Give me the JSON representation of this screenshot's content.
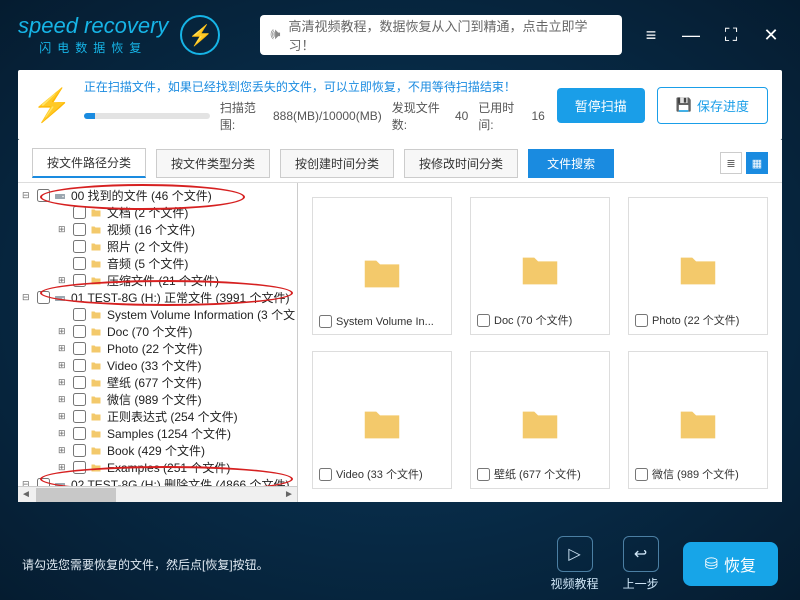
{
  "app": {
    "name": "speed recovery",
    "subtitle": "闪电数据恢复"
  },
  "promo": "高清视频教程，数据恢复从入门到精通，点击立即学习！",
  "scan": {
    "status": "正在扫描文件，如果已经找到您丢失的文件，可以立即恢复，不用等待扫描结束！",
    "range_label": "扫描范围:",
    "range_value": "888(MB)/10000(MB)",
    "found_label": "发现文件数:",
    "found_value": "40",
    "time_label": "已用时间:",
    "time_value": "16",
    "pause": "暂停扫描",
    "save": "保存进度"
  },
  "tabs": {
    "t1": "按文件路径分类",
    "t2": "按文件类型分类",
    "t3": "按创建时间分类",
    "t4": "按修改时间分类",
    "search": "文件搜索"
  },
  "tree": [
    {
      "pad": 4,
      "exp": "⊟",
      "icon": "drive",
      "label": "00 找到的文件   (46 个文件)"
    },
    {
      "pad": 40,
      "exp": "",
      "icon": "folder",
      "label": "文档     (2 个文件)"
    },
    {
      "pad": 40,
      "exp": "⊞",
      "icon": "folder",
      "label": "视频     (16 个文件)"
    },
    {
      "pad": 40,
      "exp": "",
      "icon": "folder",
      "label": "照片     (2 个文件)"
    },
    {
      "pad": 40,
      "exp": "",
      "icon": "folder",
      "label": "音频     (5 个文件)"
    },
    {
      "pad": 40,
      "exp": "⊞",
      "icon": "folder",
      "label": "压缩文件     (21 个文件)"
    },
    {
      "pad": 4,
      "exp": "⊟",
      "icon": "drive",
      "label": "01 TEST-8G (H:) 正常文件 (3991 个文件)"
    },
    {
      "pad": 40,
      "exp": "",
      "icon": "folder",
      "label": "System Volume Information     (3 个文"
    },
    {
      "pad": 40,
      "exp": "⊞",
      "icon": "folder",
      "label": "Doc     (70 个文件)"
    },
    {
      "pad": 40,
      "exp": "⊞",
      "icon": "folder",
      "label": "Photo     (22 个文件)"
    },
    {
      "pad": 40,
      "exp": "⊞",
      "icon": "folder",
      "label": "Video     (33 个文件)"
    },
    {
      "pad": 40,
      "exp": "⊞",
      "icon": "folder",
      "label": "壁纸     (677 个文件)"
    },
    {
      "pad": 40,
      "exp": "⊞",
      "icon": "folder",
      "label": "微信     (989 个文件)"
    },
    {
      "pad": 40,
      "exp": "⊞",
      "icon": "folder",
      "label": "正则表达式     (254 个文件)"
    },
    {
      "pad": 40,
      "exp": "⊞",
      "icon": "folder",
      "label": "Samples     (1254 个文件)"
    },
    {
      "pad": 40,
      "exp": "⊞",
      "icon": "folder",
      "label": "Book     (429 个文件)"
    },
    {
      "pad": 40,
      "exp": "⊞",
      "icon": "folder",
      "label": "Examples     (251 个文件)"
    },
    {
      "pad": 4,
      "exp": "⊟",
      "icon": "drive",
      "label": "02 TEST-8G (H:) 删除文件 (4866 个文件)"
    }
  ],
  "grid": [
    {
      "name": "System Volume In...",
      "count": ""
    },
    {
      "name": "Doc",
      "count": "(70 个文件)"
    },
    {
      "name": "Photo",
      "count": "(22 个文件)"
    },
    {
      "name": "Video",
      "count": "(33 个文件)"
    },
    {
      "name": "壁纸",
      "count": "(677 个文件)"
    },
    {
      "name": "微信",
      "count": "(989 个文件)"
    }
  ],
  "footer": {
    "hint": "请勾选您需要恢复的文件，然后点[恢复]按钮。",
    "video": "视频教程",
    "prev": "上一步",
    "recover": "恢复"
  }
}
